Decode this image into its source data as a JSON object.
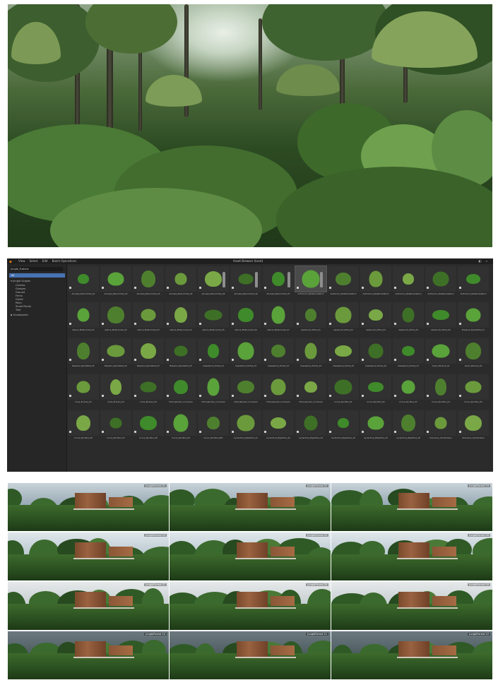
{
  "browser": {
    "window_title": "Asset Browser (local)",
    "menu": [
      "View",
      "Select",
      "Edit",
      "Batch Operations"
    ],
    "search_value": "Jungle_Fusions",
    "tree": {
      "root": "All",
      "group": "Jungle Scapes",
      "items": [
        "Cannas",
        "Grasses",
        "Ground",
        "Ferns",
        "Greek",
        "Palm",
        "Small Plants",
        "Tree"
      ],
      "unassigned": "Unassigned"
    },
    "assets": [
      "Alocasia_Macrorrhiza_01",
      "Alocasia_Macrorrhiza_02",
      "Alocasia_Macrorrhiza_03",
      "Alocasia_Macrorrhiza_04",
      "Alocasia_Macrorrhiza_05",
      "Alocasia_Macrorrhiza_06",
      "Alocasia_Macrorrhiza_07",
      "Anthurium_Pedatoradiatum",
      "Anthurium_Pedatoradiatum",
      "Anthurium_Pedatoradiatum",
      "Anthurium_Pedatoradiatum",
      "Anthurium_Pedatoradiatum",
      "Anthurium_Pedatoradiatum",
      "Alpinia_Malaccensis_01",
      "Alpinia_Malaccensis_02",
      "Alpinia_Malaccensis_03",
      "Alpinia_Malaccensis_04",
      "Alpinia_Malaccensis_05",
      "Alpinia_Malaccensis_06",
      "Alpinia_Malaccensis_07",
      "Asplenium_Nidus_01",
      "Asplenium_Nidus_02",
      "Asplenium_Nidus_03",
      "Asplenium_Nidus_04",
      "Asplenium_Nidus_05",
      "Brassica_Spectabilis_01",
      "Bessera_Spectabilis_01",
      "Bessera_Spectabilis_02",
      "Bessera_Spectabilis_03",
      "Bessera_Spectabilis_05",
      "Caesalpinia_Ferrea_01",
      "Caesalpinia_Ferrea_02",
      "Caesalpinia_Ferrea_03",
      "Caesalpinia_Ferrea_04",
      "Caesalpinia_Ferrea_05",
      "Caesalpinia_Ferrea_06",
      "Caesalpinia_Ferrea_07",
      "Carex_Ravinea_01",
      "Carex_Ravinea_02",
      "Cicas_Brunsia_03",
      "Cicas_Brunsia_04",
      "Cicas_Brunsia_05",
      "Chlorophytum_Comosum",
      "Chlorophytum_Comosum",
      "Chlorophytum_Comosum",
      "Chlorophytum_Comosum",
      "Chlorophytum_Comosum",
      "Cocos_Nucifera_01",
      "Cocos_Nucifera_02",
      "Cocos_Nucifera_03",
      "Cocos_Nucifera_04",
      "Cocos_Nucifera_05",
      "Cocos_Nucifera_06",
      "Cocos_Nucifera_07",
      "Cocos_Nucifera_08",
      "Cocos_Nucifera_09",
      "Cocos_Nucifera_B01",
      "Cyclanthus_Bipartitus_01",
      "Cyclanthus_Bipartitus_02",
      "Cyclanthus_Bipartitus_03",
      "Cyclanthus_Bipartitus_04",
      "Cyclanthus_Bipartitus_05",
      "Cyclanthus_Bipartitus_06",
      "Dracaena_Cambodiana",
      "Dracaena_Cambodiana"
    ]
  },
  "renders": [
    "JungleForest 01",
    "JungleForest 02",
    "JungleForest 03",
    "JungleForest 04",
    "JungleForest 05",
    "JungleForest 06",
    "JungleForest 07",
    "JungleForest 08",
    "JungleForest 09",
    "JungleForest 10",
    "JungleForest 11",
    "JungleForest 12"
  ],
  "colors": {
    "accent": "#4772b3",
    "panel": "#2b2b2b",
    "logo": "#e87d0d"
  }
}
